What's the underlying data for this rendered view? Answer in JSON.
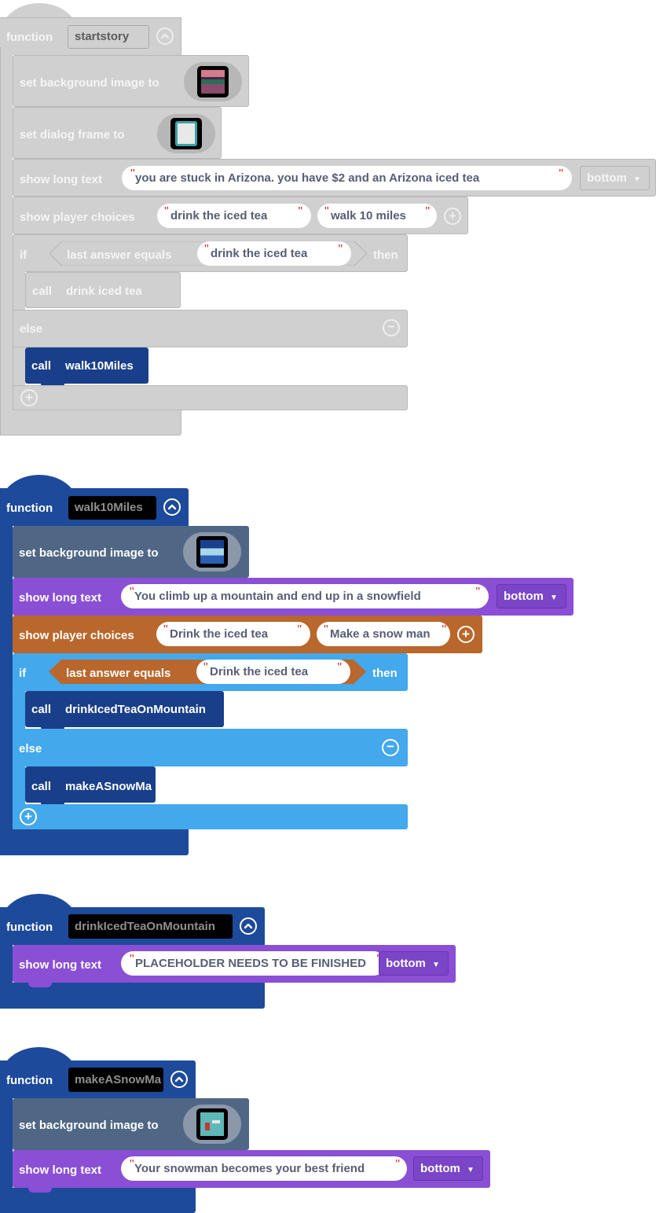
{
  "colors": {
    "disabled": "#d0d0d0",
    "disabled_border": "#b9b9b9",
    "function": "#1d4a9a",
    "call": "#1a3f8a",
    "sprite": "#4f6785",
    "text": "#8a4fd4",
    "choices": "#b9672c",
    "logic": "#43a8ec"
  },
  "func1": {
    "keyword": "function",
    "name": "startstory",
    "set_bg_label": "set background image to",
    "set_dialog_label": "set dialog frame to",
    "show_text_label": "show long text",
    "show_text_value": "you are stuck in Arizona. you have $2 and an Arizona iced tea",
    "position": "bottom",
    "choices_label": "show player choices",
    "choice1": "drink the iced tea",
    "choice2": "walk 10 miles",
    "if_label": "if",
    "cond_label": "last answer equals",
    "cond_value": "drink the iced tea",
    "then_label": "then",
    "call1_label": "call",
    "call1_name": "drink iced tea",
    "else_label": "else",
    "call2_label": "call",
    "call2_name": "walk10Miles"
  },
  "func2": {
    "keyword": "function",
    "name": "walk10Miles",
    "set_bg_label": "set background image to",
    "show_text_label": "show long text",
    "show_text_value": "You climb up a mountain and end up in a snowfield",
    "position": "bottom",
    "choices_label": "show player choices",
    "choice1": "Drink the iced tea",
    "choice2": "Make a snow man",
    "if_label": "if",
    "cond_label": "last answer equals",
    "cond_value": "Drink the iced tea",
    "then_label": "then",
    "call1_label": "call",
    "call1_name": "drinkIcedTeaOnMountain",
    "else_label": "else",
    "call2_label": "call",
    "call2_name": "makeASnowMa"
  },
  "func3": {
    "keyword": "function",
    "name": "drinkIcedTeaOnMountain",
    "show_text_label": "show long text",
    "show_text_value": "PLACEHOLDER NEEDS TO BE FINISHED",
    "position": "bottom"
  },
  "func4": {
    "keyword": "function",
    "name": "makeASnowMa",
    "set_bg_label": "set background image to",
    "show_text_label": "show long text",
    "show_text_value": "Your snowman becomes your best friend",
    "position": "bottom"
  },
  "icons": {
    "collapse": "chevron-up-circle-icon",
    "add": "plus-circle-icon",
    "remove": "minus-circle-icon",
    "dropdown": "caret-down-icon"
  }
}
